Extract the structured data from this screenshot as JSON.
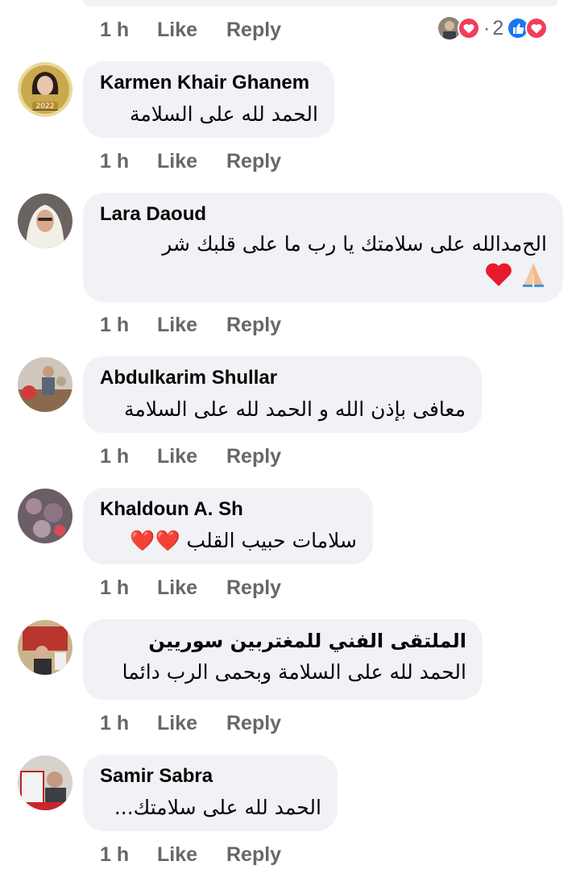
{
  "actions": {
    "time": "1 h",
    "like": "Like",
    "reply": "Reply"
  },
  "top_reactions": {
    "count": "2",
    "separator": "·"
  },
  "comments": [
    {
      "name": "Karmen Khair Ghanem",
      "text": "الحمد لله على السلامة",
      "avatar_badge": "2022"
    },
    {
      "name": "Lara Daoud",
      "text_line1": "الح￼مدالله على سلامتك يا رب ما على قلبك شر",
      "text_line2": "🙏❤️"
    },
    {
      "name": "Abdulkarim Shullar",
      "text": "معافى بإذن الله و الحمد لله على السلامة"
    },
    {
      "name": "Khaldoun A. Sh",
      "text": "سلامات حبيب القلب ❤️❤️"
    },
    {
      "name": "الملتقى الفني للمغتربين سوريين",
      "text": "الحمد لله على السلامة وبحمى الرب دائما"
    },
    {
      "name": "Samir Sabra",
      "text": "الحمد لله على سلامتك..."
    }
  ],
  "colors": {
    "bubble": "#f0f2f5",
    "meta": "#65676b",
    "like_blue": "#1877f2",
    "love_red": "#f33e58"
  },
  "icons": [
    "like-reaction-icon",
    "love-reaction-icon",
    "red-heart-emoji",
    "folded-hands-emoji"
  ]
}
